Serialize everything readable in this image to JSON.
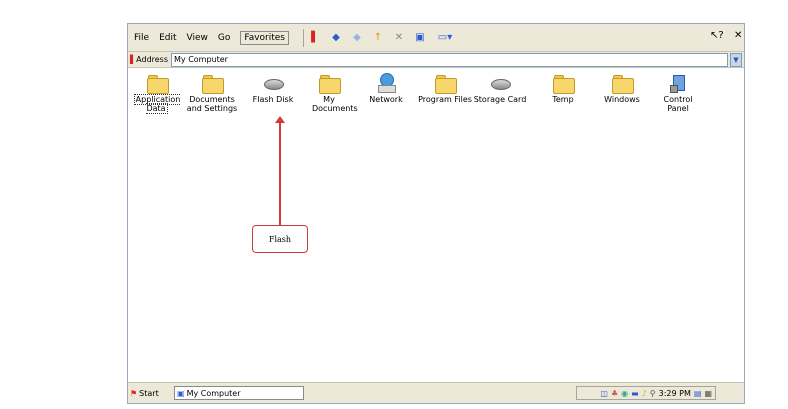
{
  "menubar": {
    "items": [
      "File",
      "Edit",
      "View",
      "Go",
      "Favorites"
    ],
    "help_icon": "help-pointer-icon",
    "close_icon": "close-icon"
  },
  "address": {
    "label": "Address",
    "value": "My Computer"
  },
  "items": [
    {
      "label": "Application Data",
      "icon": "folder"
    },
    {
      "label": "Documents and Settings",
      "icon": "folder"
    },
    {
      "label": "Flash Disk",
      "icon": "disk"
    },
    {
      "label": "My Documents",
      "icon": "folder"
    },
    {
      "label": "Network",
      "icon": "network"
    },
    {
      "label": "Program Files",
      "icon": "folder"
    },
    {
      "label": "Storage Card",
      "icon": "disk"
    },
    {
      "label": "Temp",
      "icon": "folder"
    },
    {
      "label": "Windows",
      "icon": "folder"
    },
    {
      "label": "Control Panel",
      "icon": "control-panel"
    }
  ],
  "callout": {
    "text": "Flash"
  },
  "taskbar": {
    "start_label": "Start",
    "task_label": "My Computer",
    "time": "3:29 PM"
  }
}
